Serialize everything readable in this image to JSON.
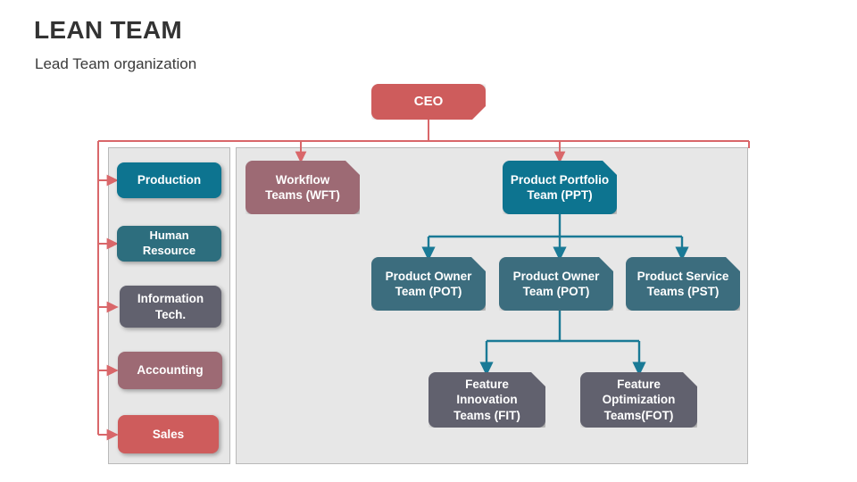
{
  "header": {
    "title": "LEAN TEAM",
    "subtitle": "Lead Team organization"
  },
  "colors": {
    "red": "#ce5c5c",
    "mauve": "#9d6a74",
    "teal_bright": "#0d7490",
    "teal_muted": "#3c6d7e",
    "slate": "#61616e",
    "connector_red": "#d9676a",
    "connector_teal": "#1a7a96",
    "panel_bg": "#e7e7e7",
    "panel_border": "#b9b9b9",
    "title_color": "#333333"
  },
  "chart_data": {
    "type": "diagram",
    "title": "LEAN TEAM",
    "subtitle": "Lead Team organization",
    "nodes": [
      {
        "id": "ceo",
        "label": "CEO",
        "color": "#ce5c5c"
      },
      {
        "id": "wft",
        "label": "Workflow\nTeams (WFT)",
        "color": "#9d6a74"
      },
      {
        "id": "ppt",
        "label": "Product Portfolio\nTeam (PPT)",
        "color": "#0d7490"
      },
      {
        "id": "pot1",
        "label": "Product Owner\nTeam (POT)",
        "color": "#3c6d7e"
      },
      {
        "id": "pot2",
        "label": "Product Owner\nTeam (POT)",
        "color": "#3c6d7e"
      },
      {
        "id": "pst",
        "label": "Product Service\nTeams (PST)",
        "color": "#3c6d7e"
      },
      {
        "id": "fit",
        "label": "Feature\nInnovation\nTeams (FIT)",
        "color": "#61616e"
      },
      {
        "id": "fot",
        "label": "Feature\nOptimization\nTeams(FOT)",
        "color": "#61616e"
      },
      {
        "id": "production",
        "label": "Production",
        "color": "#0d7490"
      },
      {
        "id": "hr",
        "label": "Human Resource",
        "color": "#2d6e7e"
      },
      {
        "id": "it",
        "label": "Information\nTech.",
        "color": "#61616e"
      },
      {
        "id": "accounting",
        "label": "Accounting",
        "color": "#9d6a74"
      },
      {
        "id": "sales",
        "label": "Sales",
        "color": "#ce5c5c"
      }
    ],
    "edges": [
      {
        "from": "ceo",
        "to": "wft"
      },
      {
        "from": "ceo",
        "to": "ppt"
      },
      {
        "from": "ceo",
        "to": "production"
      },
      {
        "from": "ceo",
        "to": "hr"
      },
      {
        "from": "ceo",
        "to": "it"
      },
      {
        "from": "ceo",
        "to": "accounting"
      },
      {
        "from": "ceo",
        "to": "sales"
      },
      {
        "from": "ppt",
        "to": "pot1"
      },
      {
        "from": "ppt",
        "to": "pot2"
      },
      {
        "from": "ppt",
        "to": "pst"
      },
      {
        "from": "pot2",
        "to": "fit"
      },
      {
        "from": "pot2",
        "to": "fot"
      }
    ]
  },
  "ceo": {
    "label": "CEO"
  },
  "departments": {
    "items": [
      {
        "label": "Production"
      },
      {
        "label": "Human Resource"
      },
      {
        "label": "Information\nTech."
      },
      {
        "label": "Accounting"
      },
      {
        "label": "Sales"
      }
    ]
  },
  "teams": {
    "wft": {
      "line1": "Workflow",
      "line2": "Teams (WFT)"
    },
    "ppt": {
      "line1": "Product Portfolio",
      "line2": "Team (PPT)"
    },
    "pot1": {
      "line1": "Product Owner",
      "line2": "Team (POT)"
    },
    "pot2": {
      "line1": "Product Owner",
      "line2": "Team (POT)"
    },
    "pst": {
      "line1": "Product Service",
      "line2": "Teams (PST)"
    },
    "fit": {
      "line1": "Feature",
      "line2": "Innovation",
      "line3": "Teams (FIT)"
    },
    "fot": {
      "line1": "Feature",
      "line2": "Optimization",
      "line3": "Teams(FOT)"
    }
  }
}
